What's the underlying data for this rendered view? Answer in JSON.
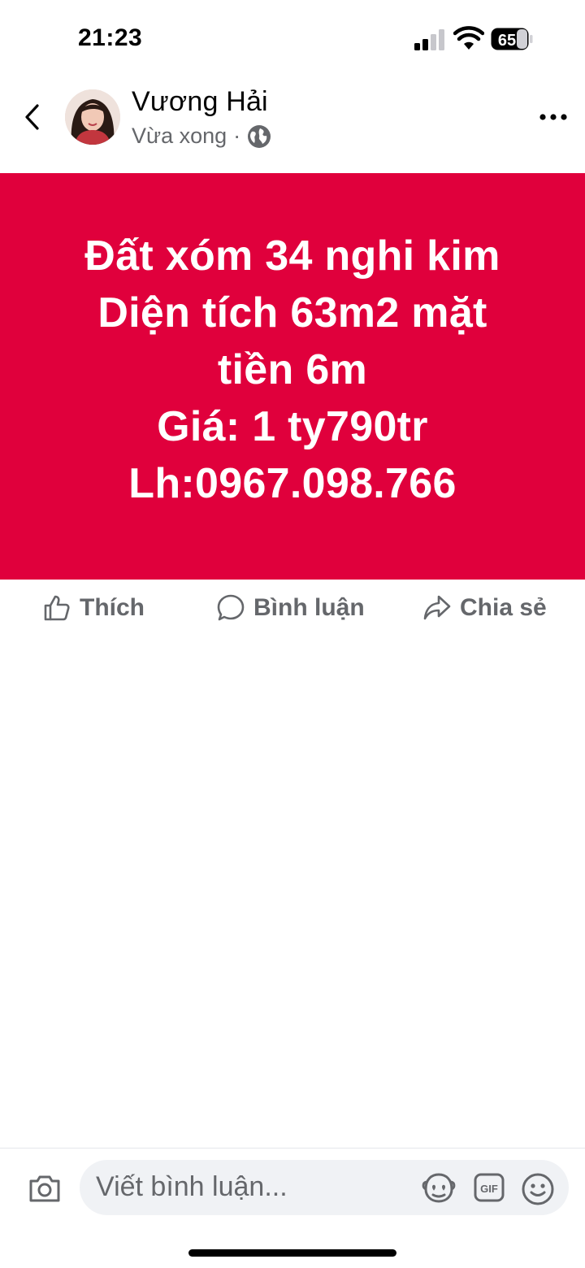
{
  "status_bar": {
    "time": "21:23",
    "battery_level": "65",
    "icons": [
      "signal-icon",
      "wifi-icon",
      "battery-icon"
    ]
  },
  "post": {
    "author": "Vương Hải",
    "timestamp": "Vừa xong",
    "separator": "·",
    "privacy_icon": "globe-icon",
    "background_color": "#e0003c",
    "text_lines": [
      "Đất xóm 34 nghi kim",
      "Diện tích 63m2 mặt",
      "tiền 6m",
      "Giá: 1 ty790tr",
      "Lh:0967.098.766"
    ]
  },
  "actions": {
    "like": "Thích",
    "comment": "Bình luận",
    "share": "Chia sẻ"
  },
  "comment_box": {
    "placeholder": "Viết bình luận..."
  },
  "colors": {
    "banner": "#e0003c",
    "secondary_text": "#65676b",
    "input_bg": "#f0f2f5"
  }
}
